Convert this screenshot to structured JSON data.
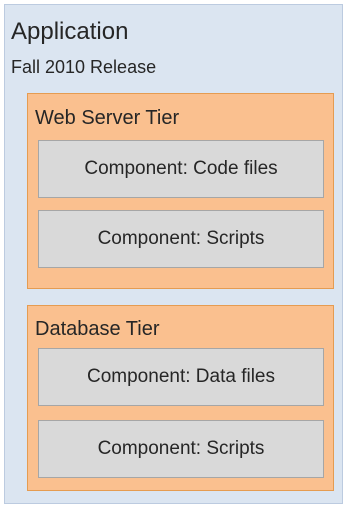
{
  "application": {
    "title": "Application",
    "subtitle": "Fall 2010 Release"
  },
  "tiers": [
    {
      "title": "Web Server Tier",
      "components": [
        "Component: Code files",
        "Component: Scripts"
      ]
    },
    {
      "title": "Database Tier",
      "components": [
        "Component: Data files",
        "Component: Scripts"
      ]
    }
  ]
}
